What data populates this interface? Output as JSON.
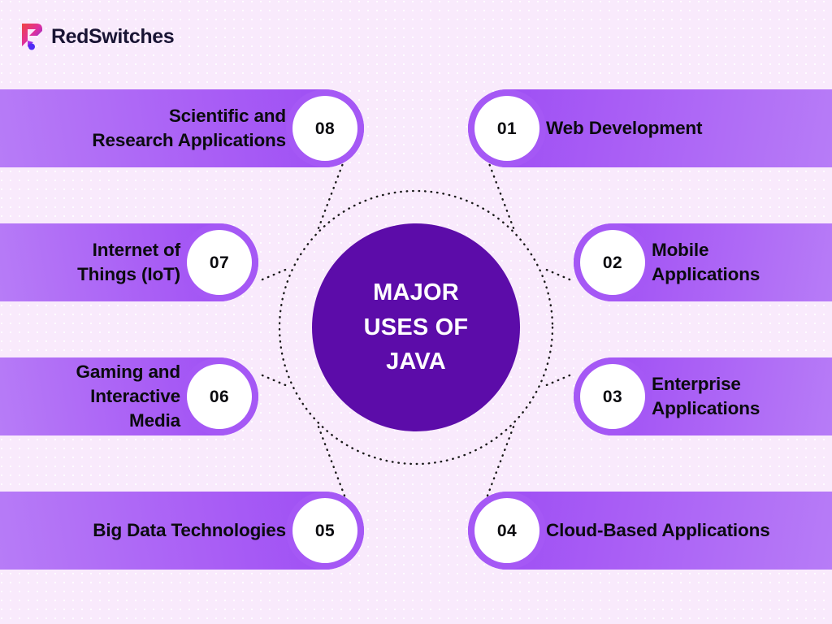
{
  "brand": {
    "name": "RedSwitches",
    "logo_icon": "redswitches-r-mark-icon",
    "mark_gradient_start": "#f0443f",
    "mark_gradient_mid": "#e0309b",
    "mark_gradient_end": "#6b2ff0",
    "wordmark_color": "#191434"
  },
  "theme": {
    "background": "#f9eafc",
    "hub_fill": "#5c0ca9",
    "hub_text_color": "#ffffff",
    "pill_gradient_inner": "#9b4bf4",
    "pill_gradient_outer": "#b77cf7",
    "badge_ring": "#a558f5",
    "badge_fill": "#ffffff",
    "label_color": "#0b0b0f",
    "connector_color": "#1a1a1a"
  },
  "hub": {
    "title_lines": [
      "MAJOR",
      "USES OF",
      "JAVA"
    ],
    "title": "MAJOR USES OF JAVA"
  },
  "items": [
    {
      "number": "01",
      "label": "Web Development",
      "lines": [
        "Web Development"
      ],
      "side": "right"
    },
    {
      "number": "02",
      "label": "Mobile Applications",
      "lines": [
        "Mobile",
        "Applications"
      ],
      "side": "right"
    },
    {
      "number": "03",
      "label": "Enterprise Applications",
      "lines": [
        "Enterprise",
        "Applications"
      ],
      "side": "right"
    },
    {
      "number": "04",
      "label": "Cloud-Based Applications",
      "lines": [
        "Cloud-Based Applications"
      ],
      "side": "right"
    },
    {
      "number": "05",
      "label": "Big Data Technologies",
      "lines": [
        "Big Data Technologies"
      ],
      "side": "left"
    },
    {
      "number": "06",
      "label": "Gaming and Interactive Media",
      "lines": [
        "Gaming and",
        "Interactive",
        "Media"
      ],
      "side": "left"
    },
    {
      "number": "07",
      "label": "Internet of Things (IoT)",
      "lines": [
        "Internet of",
        "Things (IoT)"
      ],
      "side": "left"
    },
    {
      "number": "08",
      "label": "Scientific and Research Applications",
      "lines": [
        "Scientific and",
        "Research Applications"
      ],
      "side": "left"
    }
  ]
}
